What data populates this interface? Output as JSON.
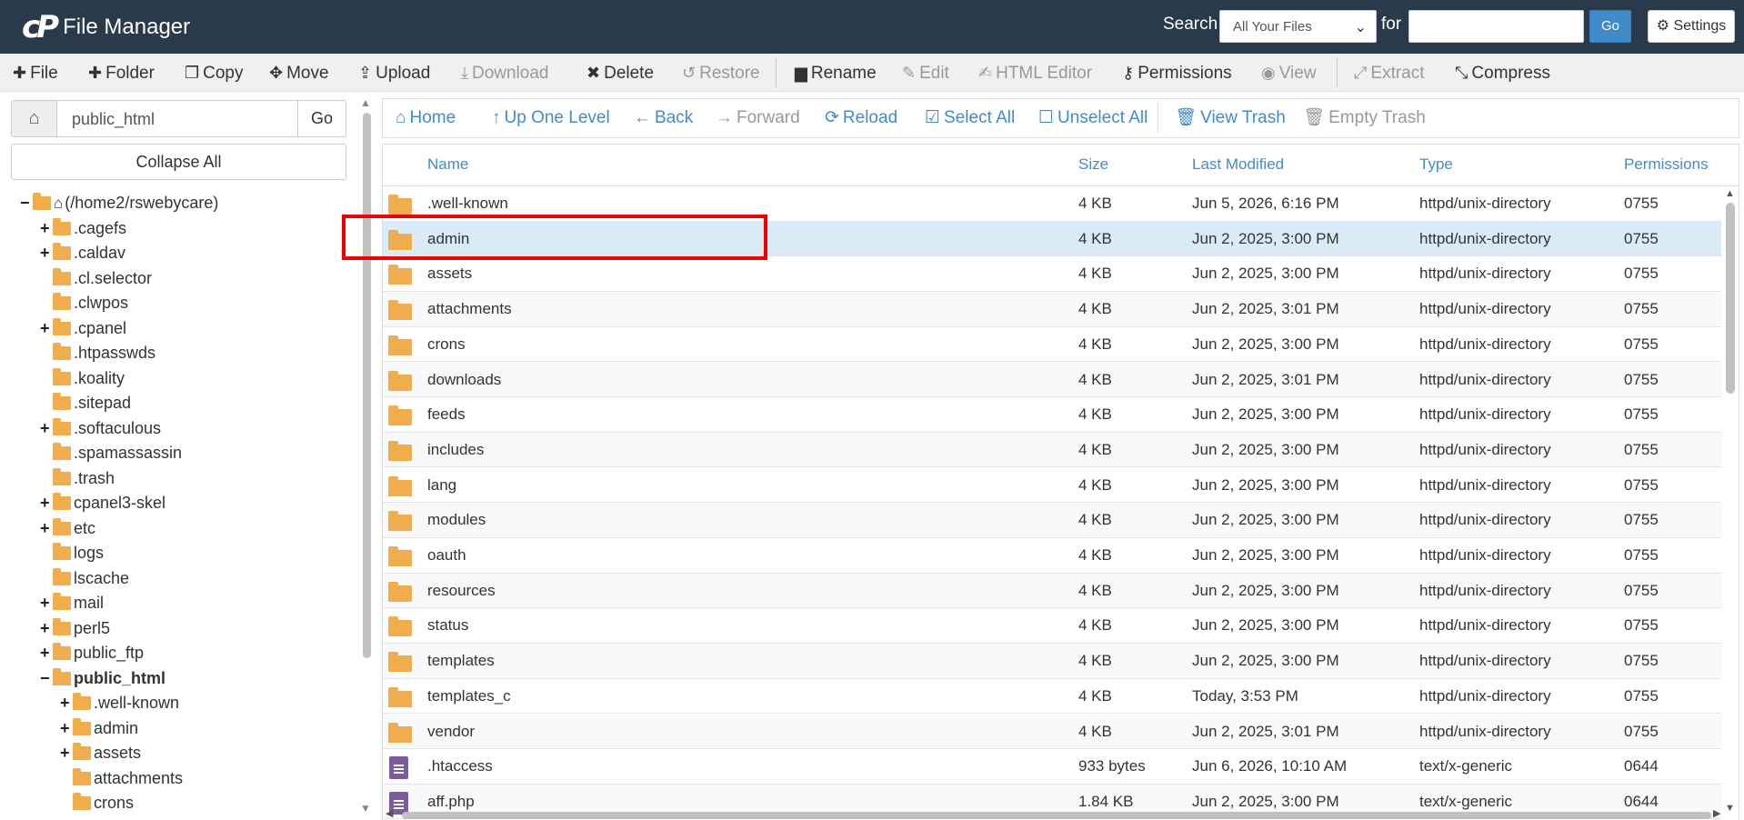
{
  "header": {
    "app_title": "File Manager",
    "logo_mark": "cP",
    "search_label": "Search",
    "search_scope": "All Your Files",
    "for_label": "for",
    "search_value": "",
    "go_label": "Go",
    "settings_label": "Settings"
  },
  "toolbar": {
    "file": "File",
    "folder": "Folder",
    "copy": "Copy",
    "move": "Move",
    "upload": "Upload",
    "download": "Download",
    "delete": "Delete",
    "restore": "Restore",
    "rename": "Rename",
    "edit": "Edit",
    "html_editor": "HTML Editor",
    "permissions": "Permissions",
    "view": "View",
    "extract": "Extract",
    "compress": "Compress"
  },
  "left": {
    "path_value": "public_html",
    "go_label": "Go",
    "collapse_all": "Collapse All"
  },
  "tree": [
    {
      "label": "(/home2/rswebycare)",
      "toggle": "−",
      "level": 0,
      "home": true,
      "open": true
    },
    {
      "label": ".cagefs",
      "toggle": "+",
      "level": 1
    },
    {
      "label": ".caldav",
      "toggle": "+",
      "level": 1
    },
    {
      "label": ".cl.selector",
      "toggle": "",
      "level": 1
    },
    {
      "label": ".clwpos",
      "toggle": "",
      "level": 1
    },
    {
      "label": ".cpanel",
      "toggle": "+",
      "level": 1
    },
    {
      "label": ".htpasswds",
      "toggle": "",
      "level": 1
    },
    {
      "label": ".koality",
      "toggle": "",
      "level": 1
    },
    {
      "label": ".sitepad",
      "toggle": "",
      "level": 1
    },
    {
      "label": ".softaculous",
      "toggle": "+",
      "level": 1
    },
    {
      "label": ".spamassassin",
      "toggle": "",
      "level": 1
    },
    {
      "label": ".trash",
      "toggle": "",
      "level": 1
    },
    {
      "label": "cpanel3-skel",
      "toggle": "+",
      "level": 1
    },
    {
      "label": "etc",
      "toggle": "+",
      "level": 1
    },
    {
      "label": "logs",
      "toggle": "",
      "level": 1
    },
    {
      "label": "lscache",
      "toggle": "",
      "level": 1
    },
    {
      "label": "mail",
      "toggle": "+",
      "level": 1
    },
    {
      "label": "perl5",
      "toggle": "+",
      "level": 1
    },
    {
      "label": "public_ftp",
      "toggle": "+",
      "level": 1
    },
    {
      "label": "public_html",
      "toggle": "−",
      "level": 1,
      "bold": true,
      "open": true
    },
    {
      "label": ".well-known",
      "toggle": "+",
      "level": 2
    },
    {
      "label": "admin",
      "toggle": "+",
      "level": 2
    },
    {
      "label": "assets",
      "toggle": "+",
      "level": 2
    },
    {
      "label": "attachments",
      "toggle": "",
      "level": 2
    },
    {
      "label": "crons",
      "toggle": "",
      "level": 2
    }
  ],
  "nav": {
    "home": "Home",
    "up": "Up One Level",
    "back": "Back",
    "forward": "Forward",
    "reload": "Reload",
    "select_all": "Select All",
    "unselect_all": "Unselect All",
    "view_trash": "View Trash",
    "empty_trash": "Empty Trash"
  },
  "columns": {
    "name": "Name",
    "size": "Size",
    "modified": "Last Modified",
    "type": "Type",
    "perms": "Permissions"
  },
  "files": [
    {
      "name": ".well-known",
      "size": "4 KB",
      "modified": "Jun 5, 2026, 6:16 PM",
      "type": "httpd/unix-directory",
      "perms": "0755",
      "kind": "folder"
    },
    {
      "name": "admin",
      "size": "4 KB",
      "modified": "Jun 2, 2025, 3:00 PM",
      "type": "httpd/unix-directory",
      "perms": "0755",
      "kind": "folder",
      "selected": true
    },
    {
      "name": "assets",
      "size": "4 KB",
      "modified": "Jun 2, 2025, 3:00 PM",
      "type": "httpd/unix-directory",
      "perms": "0755",
      "kind": "folder"
    },
    {
      "name": "attachments",
      "size": "4 KB",
      "modified": "Jun 2, 2025, 3:01 PM",
      "type": "httpd/unix-directory",
      "perms": "0755",
      "kind": "folder"
    },
    {
      "name": "crons",
      "size": "4 KB",
      "modified": "Jun 2, 2025, 3:00 PM",
      "type": "httpd/unix-directory",
      "perms": "0755",
      "kind": "folder"
    },
    {
      "name": "downloads",
      "size": "4 KB",
      "modified": "Jun 2, 2025, 3:01 PM",
      "type": "httpd/unix-directory",
      "perms": "0755",
      "kind": "folder"
    },
    {
      "name": "feeds",
      "size": "4 KB",
      "modified": "Jun 2, 2025, 3:00 PM",
      "type": "httpd/unix-directory",
      "perms": "0755",
      "kind": "folder"
    },
    {
      "name": "includes",
      "size": "4 KB",
      "modified": "Jun 2, 2025, 3:00 PM",
      "type": "httpd/unix-directory",
      "perms": "0755",
      "kind": "folder"
    },
    {
      "name": "lang",
      "size": "4 KB",
      "modified": "Jun 2, 2025, 3:00 PM",
      "type": "httpd/unix-directory",
      "perms": "0755",
      "kind": "folder"
    },
    {
      "name": "modules",
      "size": "4 KB",
      "modified": "Jun 2, 2025, 3:00 PM",
      "type": "httpd/unix-directory",
      "perms": "0755",
      "kind": "folder"
    },
    {
      "name": "oauth",
      "size": "4 KB",
      "modified": "Jun 2, 2025, 3:00 PM",
      "type": "httpd/unix-directory",
      "perms": "0755",
      "kind": "folder"
    },
    {
      "name": "resources",
      "size": "4 KB",
      "modified": "Jun 2, 2025, 3:00 PM",
      "type": "httpd/unix-directory",
      "perms": "0755",
      "kind": "folder"
    },
    {
      "name": "status",
      "size": "4 KB",
      "modified": "Jun 2, 2025, 3:00 PM",
      "type": "httpd/unix-directory",
      "perms": "0755",
      "kind": "folder"
    },
    {
      "name": "templates",
      "size": "4 KB",
      "modified": "Jun 2, 2025, 3:00 PM",
      "type": "httpd/unix-directory",
      "perms": "0755",
      "kind": "folder"
    },
    {
      "name": "templates_c",
      "size": "4 KB",
      "modified": "Today, 3:53 PM",
      "type": "httpd/unix-directory",
      "perms": "0755",
      "kind": "folder"
    },
    {
      "name": "vendor",
      "size": "4 KB",
      "modified": "Jun 2, 2025, 3:01 PM",
      "type": "httpd/unix-directory",
      "perms": "0755",
      "kind": "folder"
    },
    {
      "name": ".htaccess",
      "size": "933 bytes",
      "modified": "Jun 6, 2026, 10:10 AM",
      "type": "text/x-generic",
      "perms": "0644",
      "kind": "file"
    },
    {
      "name": "aff.php",
      "size": "1.84 KB",
      "modified": "Jun 2, 2025, 3:00 PM",
      "type": "text/x-generic",
      "perms": "0644",
      "kind": "file"
    }
  ],
  "colors": {
    "header_bg": "#293a4a",
    "link_blue": "#428bca",
    "folder": "#f0ad4e",
    "selected_row": "#d9ebf7",
    "highlight_box": "#ee0000"
  }
}
